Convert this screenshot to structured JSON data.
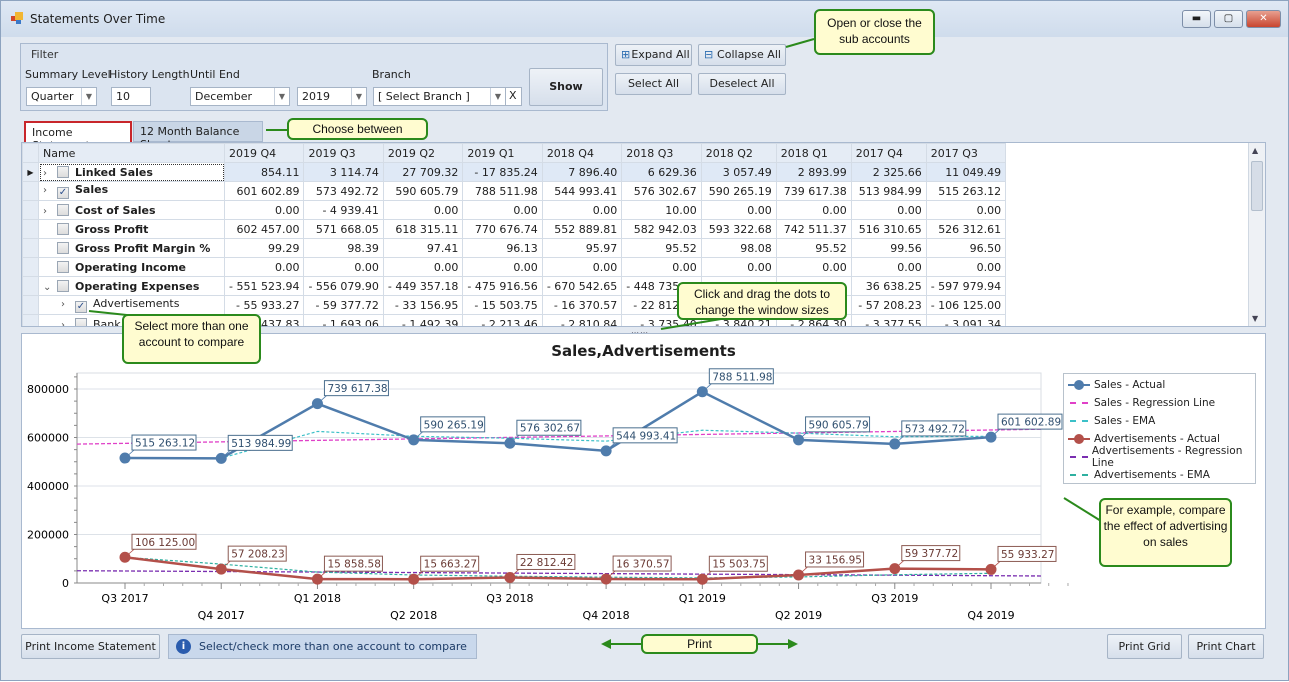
{
  "window": {
    "title": "Statements Over Time",
    "minimize": "▬",
    "maximize": "▢",
    "close": "✕"
  },
  "filter": {
    "title": "Filter",
    "summary_level": {
      "label": "Summary Level",
      "value": "Quarter"
    },
    "history_length": {
      "label": "History Length",
      "value": "10"
    },
    "until_end": {
      "label": "Until End",
      "month": "December",
      "year": "2019"
    },
    "branch": {
      "label": "Branch",
      "value": "[ Select Branch ]",
      "clear": "X"
    },
    "show": "Show"
  },
  "toolbar": {
    "expand_all": "Expand All",
    "collapse_all": "Collapse All",
    "select_all": "Select All",
    "deselect_all": "Deselect All"
  },
  "tabs": [
    {
      "label": "Income Statement",
      "active": true
    },
    {
      "label": "12 Month Balance Sheet",
      "active": false
    }
  ],
  "grid": {
    "name_header": "Name",
    "columns": [
      "2019 Q4",
      "2019 Q3",
      "2019 Q2",
      "2019 Q1",
      "2018 Q4",
      "2018 Q3",
      "2018 Q2",
      "2018 Q1",
      "2017 Q4",
      "2017 Q3"
    ],
    "rows": [
      {
        "name": "Linked Sales",
        "bold": true,
        "expander": ">",
        "checked": false,
        "current": true,
        "values": [
          "854.11",
          "3 114.74",
          "27 709.32",
          "- 17 835.24",
          "7 896.40",
          "6 629.36",
          "3 057.49",
          "2 893.99",
          "2 325.66",
          "11 049.49"
        ]
      },
      {
        "name": "Sales",
        "bold": true,
        "expander": ">",
        "checked": true,
        "values": [
          "601 602.89",
          "573 492.72",
          "590 605.79",
          "788 511.98",
          "544 993.41",
          "576 302.67",
          "590 265.19",
          "739 617.38",
          "513 984.99",
          "515 263.12"
        ]
      },
      {
        "name": "Cost of Sales",
        "bold": true,
        "expander": ">",
        "checked": false,
        "values": [
          "0.00",
          "- 4 939.41",
          "0.00",
          "0.00",
          "0.00",
          "10.00",
          "0.00",
          "0.00",
          "0.00",
          "0.00"
        ]
      },
      {
        "name": "Gross Profit",
        "bold": true,
        "expander": "",
        "checked": false,
        "values": [
          "602 457.00",
          "571 668.05",
          "618 315.11",
          "770 676.74",
          "552 889.81",
          "582 942.03",
          "593 322.68",
          "742 511.37",
          "516 310.65",
          "526 312.61"
        ]
      },
      {
        "name": "Gross Profit Margin %",
        "bold": true,
        "expander": "",
        "checked": false,
        "values": [
          "99.29",
          "98.39",
          "97.41",
          "96.13",
          "95.97",
          "95.52",
          "98.08",
          "95.52",
          "99.56",
          "96.50"
        ]
      },
      {
        "name": "Operating Income",
        "bold": true,
        "expander": "",
        "checked": false,
        "values": [
          "0.00",
          "0.00",
          "0.00",
          "0.00",
          "0.00",
          "0.00",
          "0.00",
          "0.00",
          "0.00",
          "0.00"
        ]
      },
      {
        "name": "Operating Expenses",
        "bold": true,
        "expander": "v",
        "checked": false,
        "values": [
          "- 551 523.94",
          "- 556 079.90",
          "- 449 357.18",
          "- 475 916.56",
          "- 670 542.65",
          "- 448 735.47",
          "",
          "",
          "36 638.25",
          "- 597 979.94"
        ]
      },
      {
        "name": "Advertisements",
        "bold": false,
        "indent": 1,
        "expander": ">",
        "checked": true,
        "values": [
          "- 55 933.27",
          "- 59 377.72",
          "- 33 156.95",
          "- 15 503.75",
          "- 16 370.57",
          "- 22 812.42",
          "- 15 663.27",
          "- 15 858.58",
          "- 57 208.23",
          "- 106 125.00"
        ]
      },
      {
        "name": "Bank",
        "bold": false,
        "indent": 1,
        "expander": ">",
        "checked": false,
        "values": [
          "- 437.83",
          "- 1 693.06",
          "- 1 492.39",
          "- 2 213.46",
          "- 2 810.84",
          "- 3 735.40",
          "- 3 840.21",
          "- 2 864.30",
          "- 3 377.55",
          "- 3 091.34"
        ]
      }
    ]
  },
  "chart_data": {
    "type": "line",
    "title": "Sales,Advertisements",
    "categories": [
      "Q3 2017",
      "Q4 2017",
      "Q1 2018",
      "Q2 2018",
      "Q3 2018",
      "Q4 2018",
      "Q1 2019",
      "Q2 2019",
      "Q3 2019",
      "Q4 2019"
    ],
    "ylim": [
      0,
      860000
    ],
    "yticks": [
      "0",
      "200000",
      "400000",
      "600000",
      "800000"
    ],
    "grid": true,
    "legend_position": "right",
    "series": [
      {
        "name": "Sales - Actual",
        "kind": "actual",
        "color": "#4f7cac",
        "values": [
          515263.12,
          513984.99,
          739617.38,
          590265.19,
          576302.67,
          544993.41,
          788511.98,
          590265.19,
          573492.72,
          601602.89
        ],
        "labels": [
          "515 263.12",
          "513 984.99",
          "739 617.38",
          "590 265.19",
          "576 302.67",
          "544 993.41",
          "788 511.98",
          "590 605.79",
          "573 492.72",
          "601 602.89"
        ]
      },
      {
        "name": "Sales - Regression Line",
        "kind": "regression",
        "of": 0,
        "color": "#e040c8"
      },
      {
        "name": "Sales - EMA",
        "kind": "ema",
        "color": "#3cc0c8",
        "values": [
          515263,
          515000,
          625000,
          605000,
          597000,
          585000,
          630000,
          618000,
          603000,
          605000
        ]
      },
      {
        "name": "Advertisements - Actual",
        "kind": "actual",
        "color": "#b3504a",
        "values": [
          106125.0,
          57208.23,
          15858.58,
          15663.27,
          22812.42,
          16370.57,
          15503.75,
          33156.95,
          59377.72,
          55933.27
        ],
        "labels": [
          "106 125.00",
          "57 208.23",
          "15 858.58",
          "15 663.27",
          "22 812.42",
          "16 370.57",
          "15 503.75",
          "33 156.95",
          "59 377.72",
          "55 933.27"
        ]
      },
      {
        "name": "Advertisements - Regression Line",
        "kind": "regression",
        "of": 3,
        "color": "#7a2eb0"
      },
      {
        "name": "Advertisements - EMA",
        "kind": "ema",
        "color": "#2eb0a0",
        "values": [
          106125,
          78000,
          45000,
          33000,
          28000,
          24000,
          21000,
          25000,
          34000,
          40000
        ]
      }
    ]
  },
  "callouts": {
    "subaccounts": "Open or close the sub accounts",
    "choose": "Choose between",
    "drag": "Click and drag the dots to change the window sizes",
    "select_more": "Select more than one account to compare",
    "example": "For example, compare the effect of advertising on sales",
    "print": "Print"
  },
  "bottom": {
    "print_income_statement": "Print Income Statement",
    "info": "Select/check more than one account to compare",
    "info_icon": "i",
    "print_grid": "Print Grid",
    "print_chart": "Print Chart"
  }
}
